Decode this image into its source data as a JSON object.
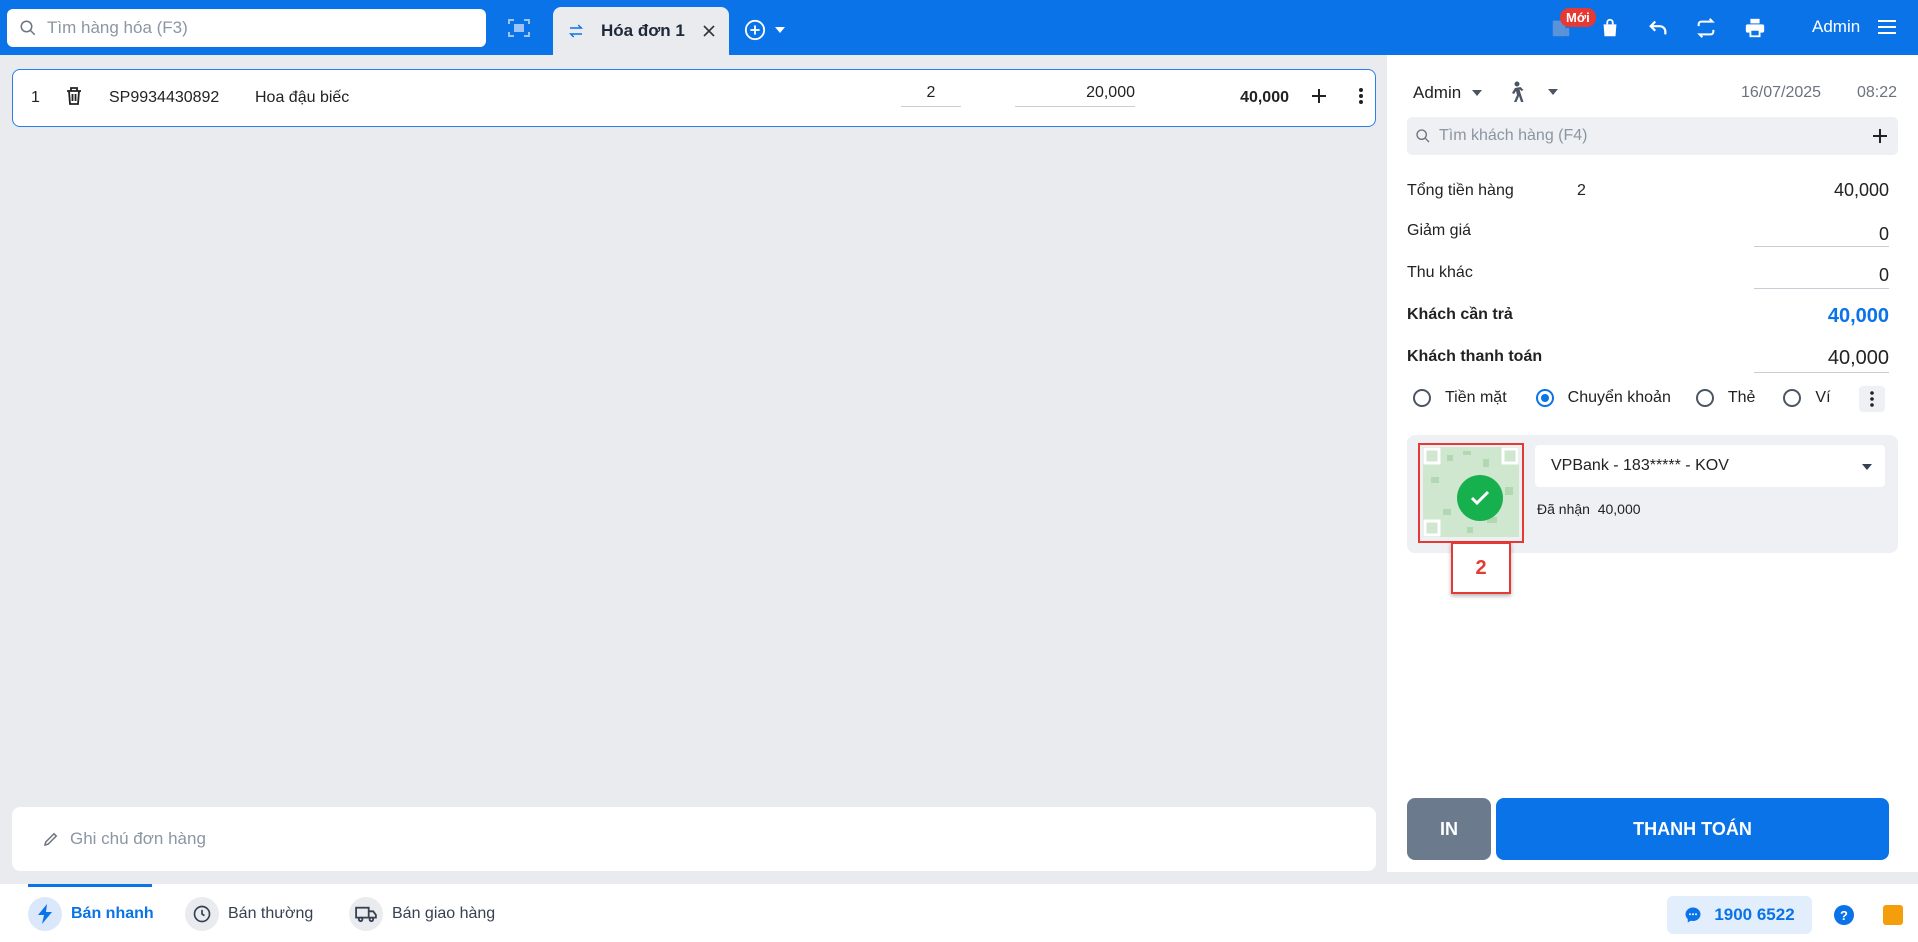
{
  "topbar": {
    "search_placeholder": "Tìm hàng hóa (F3)",
    "tab_title": "Hóa đơn 1",
    "badge_new": "Mới",
    "user": "Admin"
  },
  "order": {
    "row": {
      "index": "1",
      "code": "SP9934430892",
      "name": "Hoa đậu biếc",
      "qty": "2",
      "price": "20,000",
      "total": "40,000"
    },
    "note_placeholder": "Ghi chú đơn hàng"
  },
  "panel": {
    "seller": "Admin",
    "date": "16/07/2025",
    "time": "08:22",
    "customer_placeholder": "Tìm khách hàng (F4)",
    "summary": {
      "subtotal_label": "Tổng tiền hàng",
      "subtotal_qty": "2",
      "subtotal_value": "40,000",
      "discount_label": "Giảm giá",
      "discount_value": "0",
      "other_label": "Thu khác",
      "other_value": "0",
      "due_label": "Khách cần trả",
      "due_value": "40,000",
      "paid_label": "Khách thanh toán",
      "paid_value": "40,000"
    },
    "methods": [
      "Tiền mặt",
      "Chuyển khoản",
      "Thẻ",
      "Ví"
    ],
    "selected_method": "Chuyển khoản",
    "bank": "VPBank - 183***** - KOV",
    "received_label": "Đã nhận",
    "received_value": "40,000",
    "callout": "2",
    "print_label": "IN",
    "pay_label": "THANH TOÁN"
  },
  "bottom": {
    "nav": [
      "Bán nhanh",
      "Bán thường",
      "Bán giao hàng"
    ],
    "active": "Bán nhanh",
    "hotline": "1900 6522",
    "help": "?"
  },
  "colors": {
    "brand": "#0a73e8",
    "success": "#17b04f",
    "highlight": "#e53935"
  }
}
